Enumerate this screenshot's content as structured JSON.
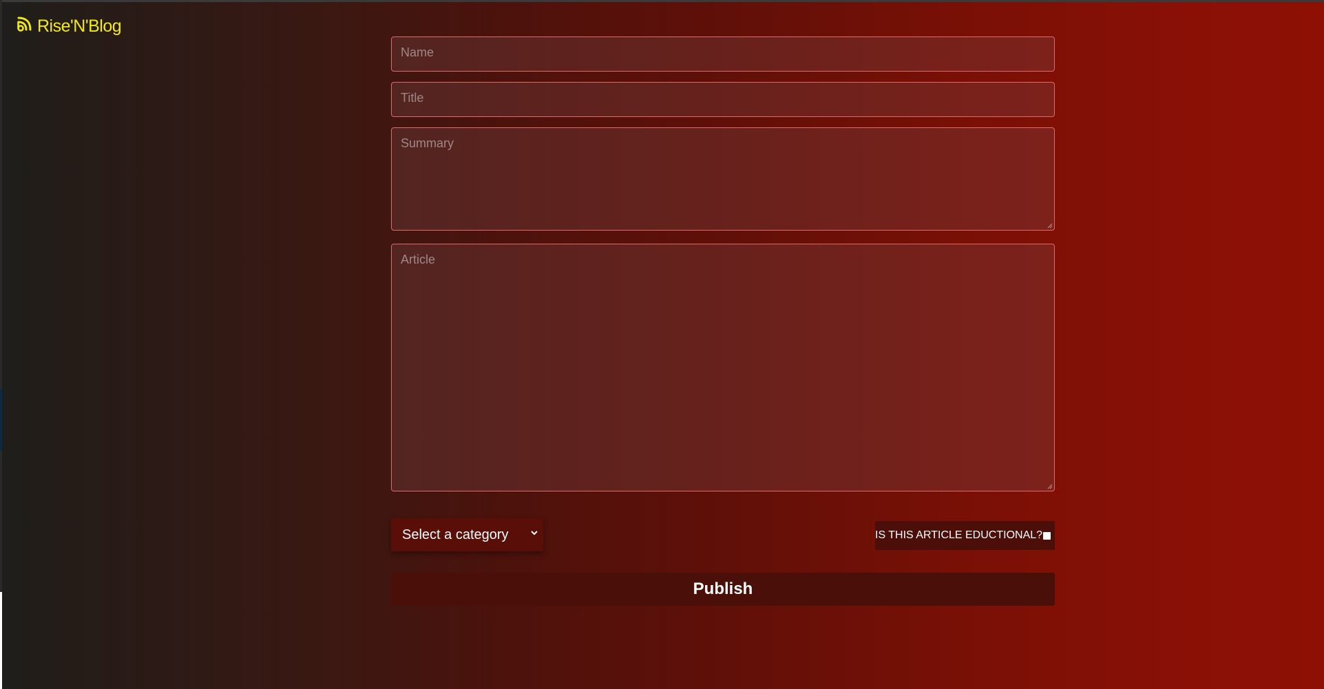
{
  "brand": {
    "name": "Rise'N'Blog",
    "icon": "rss-feed-icon",
    "color": "#f2ea10"
  },
  "form": {
    "name_placeholder": "Name",
    "title_placeholder": "Title",
    "summary_placeholder": "Summary",
    "article_placeholder": "Article",
    "category_select": "Select a category",
    "educational_label": "IS THIS ARTICLE EDUCTIONAL?",
    "educational_checked": false,
    "publish_label": "Publish"
  },
  "colors": {
    "gradient_start": "#1e1e1a",
    "gradient_end": "#8e1004",
    "field_border": "#e06a6a"
  }
}
